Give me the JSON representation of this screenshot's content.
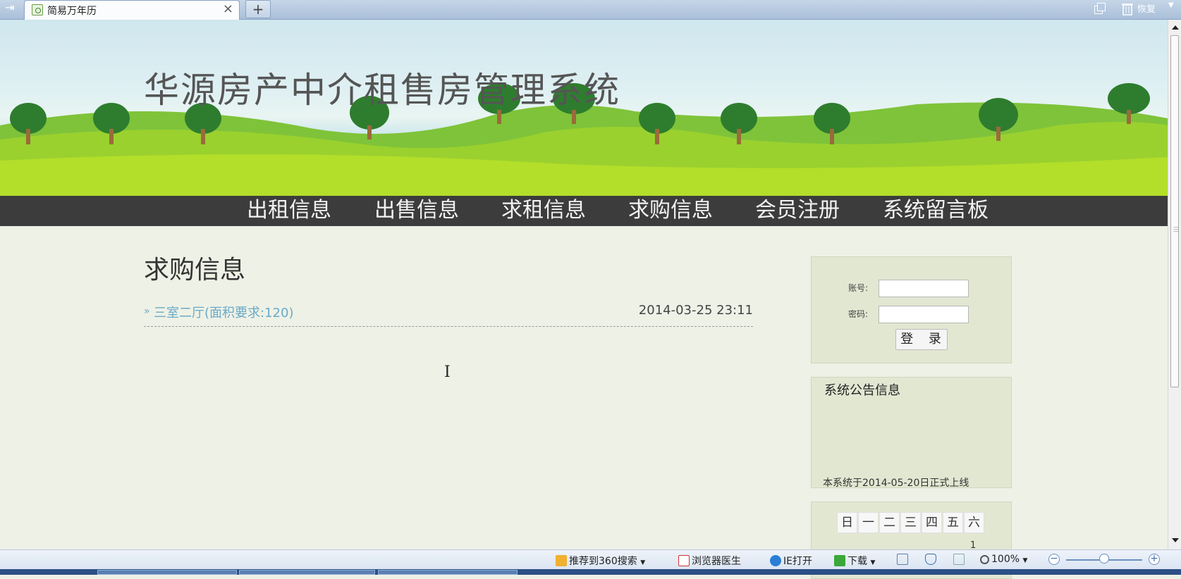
{
  "browser": {
    "tab_title": "简易万年历",
    "tab_close": "×",
    "new_tab": "+",
    "restore_label": "恢复"
  },
  "site": {
    "title": "华源房产中介租售房管理系统"
  },
  "nav": {
    "items": [
      "出租信息",
      "出售信息",
      "求租信息",
      "求购信息",
      "会员注册",
      "系统留言板"
    ]
  },
  "main": {
    "heading": "求购信息",
    "rows": [
      {
        "bullet": "»",
        "link": "三室二厅(面积要求:120)",
        "date": "2014-03-25 23:11"
      }
    ]
  },
  "login": {
    "account_label": "账号:",
    "password_label": "密码:",
    "button_label": "登 录"
  },
  "notice": {
    "title": "系统公告信息",
    "text": "本系统于2014-05-20日正式上线"
  },
  "calendar": {
    "weekdays": [
      "日",
      "一",
      "二",
      "三",
      "四",
      "五",
      "六"
    ],
    "first_day": "1"
  },
  "statusbar": {
    "recommend": "推荐到360搜索",
    "doctor": "浏览器医生",
    "ie_open": "IE打开",
    "download": "下载",
    "zoom": "100%",
    "zoom_level": 0.5
  }
}
